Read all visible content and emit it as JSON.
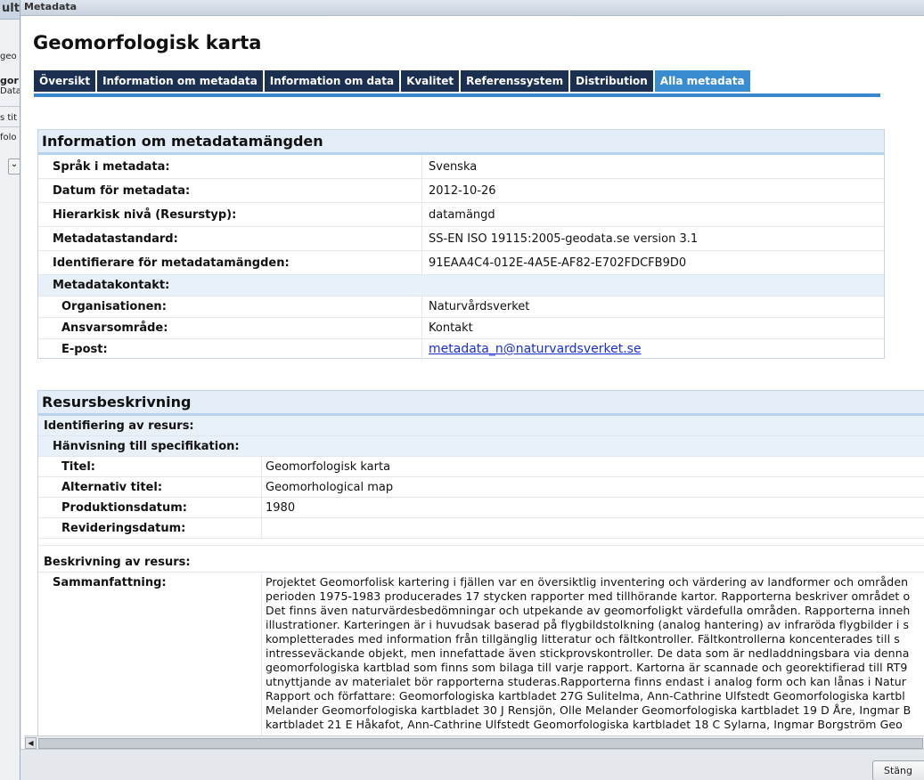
{
  "background_window": {
    "title_fragment": "ulta",
    "lines": [
      "geo",
      "gor",
      "Data",
      "s tit",
      "folo",
      "⌄"
    ]
  },
  "dialog": {
    "window_title": "Metadata",
    "page_title": "Geomorfologisk karta",
    "tabs": [
      {
        "label": "Översikt",
        "active": false
      },
      {
        "label": "Information om metadata",
        "active": false
      },
      {
        "label": "Information om data",
        "active": false
      },
      {
        "label": "Kvalitet",
        "active": false
      },
      {
        "label": "Referenssystem",
        "active": false
      },
      {
        "label": "Distribution",
        "active": false
      },
      {
        "label": "Alla metadata",
        "active": true
      }
    ],
    "metadata_section": {
      "heading": "Information om metadatamängden",
      "rows": [
        {
          "label": "Språk i metadata:",
          "value": "Svenska"
        },
        {
          "label": "Datum för metadata:",
          "value": "2012-10-26"
        },
        {
          "label": "Hierarkisk nivå (Resurstyp):",
          "value": "datamängd"
        },
        {
          "label": "Metadatastandard:",
          "value": "SS-EN ISO 19115:2005-geodata.se version 3.1"
        },
        {
          "label": "Identifierare för metadatamängden:",
          "value": "91EAA4C4-012E-4A5E-AF82-E702FDCFB9D0"
        }
      ],
      "contact_heading": "Metadatakontakt:",
      "contact_rows": [
        {
          "label": "Organisationen:",
          "value": "Naturvårdsverket"
        },
        {
          "label": "Ansvarsområde:",
          "value": "Kontakt"
        }
      ],
      "email_label": "E-post:",
      "email_value": "metadata_n@naturvardsverket.se"
    },
    "resource_section": {
      "heading": "Resursbeskrivning",
      "identification_heading": "Identifiering av resurs:",
      "specification_heading": "Hänvisning till specifikation:",
      "spec_rows": [
        {
          "label": "Titel:",
          "value": "Geomorfologisk karta"
        },
        {
          "label": "Alternativ titel:",
          "value": "Geomorhological map"
        },
        {
          "label": "Produktionsdatum:",
          "value": "1980"
        },
        {
          "label": "Revideringsdatum:",
          "value": ""
        }
      ],
      "description_heading": "Beskrivning av resurs:",
      "summary_label": "Sammanfattning:",
      "summary_lines": [
        "Projektet Geomorfolisk kartering i fjällen var en översiktlig inventering och värdering av landformer och områden",
        "perioden 1975-1983 producerades 17 stycken rapporter med tillhörande kartor. Rapporterna beskriver området o",
        "Det finns även naturvärdesbedömningar och utpekande av geomorfoligkt värdefulla områden. Rapporterna inneh",
        "illustrationer. Karteringen är i huvudsak baserad på flygbildstolkning (analog hantering) av infraröda flygbilder i s",
        "kompletterades med information från tillgänglig litteratur och fältkontroller. Fältkontrollerna koncenterades till s",
        "intresseväckande objekt, men innefattade även stickprovskontroller. De data som är nedladdningsbara via denna",
        "geomorfologiska kartblad som finns som bilaga till varje rapport. Kartorna är scannade och georektifierad till RT9",
        "utnyttjande av materialet bör rapporterna studeras.Rapporterna finns endast i analog form och kan lånas i Natur",
        "Rapport och författare: Geomorfologiska kartbladet 27G Sulitelma, Ann-Cathrine Ulfstedt Geomorfologiska kartbl",
        "Melander Geomorfologiska kartbladet 30 J Rensjön, Olle Melander Geomorfologiska kartbladet 19 D Åre, Ingmar B",
        "kartbladet 21 E Håkafot, Ann-Cathrine Ulfstedt Geomorfologiska kartbladet 18 C Sylarna, Ingmar Borgström Geo"
      ]
    },
    "close_button": "Stäng"
  }
}
